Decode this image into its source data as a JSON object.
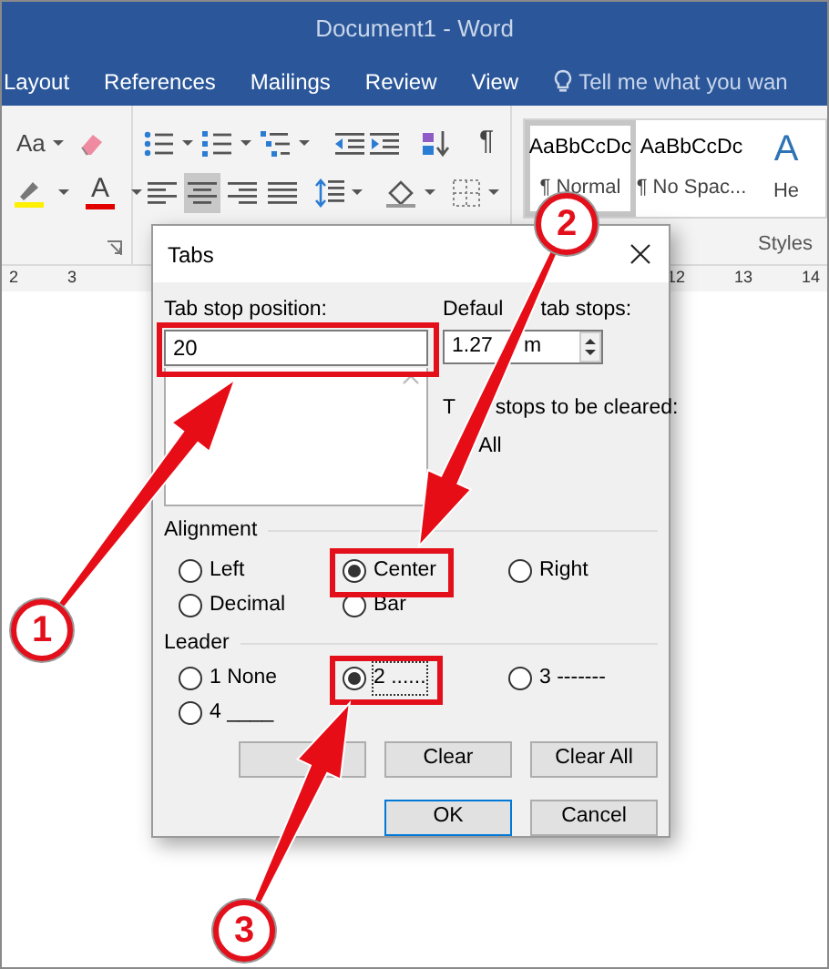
{
  "window": {
    "title": "Document1 - Word"
  },
  "ribbon_tabs": [
    {
      "label": "Layout"
    },
    {
      "label": "References"
    },
    {
      "label": "Mailings"
    },
    {
      "label": "Review"
    },
    {
      "label": "View"
    }
  ],
  "tell_me": {
    "placeholder": "Tell me what you wan"
  },
  "font_group": {
    "font_size_button": "Aa",
    "font_color_button": "A"
  },
  "paragraph_group": {
    "show_marks_button": "¶"
  },
  "paragraph_alignment": [
    {
      "selected": false
    },
    {
      "selected": true
    },
    {
      "selected": false
    },
    {
      "selected": false
    }
  ],
  "styles": {
    "group_label": "Styles",
    "items": [
      {
        "preview": "AaBbCcDc",
        "name": "¶ Normal",
        "selected": true
      },
      {
        "preview": "AaBbCcDc",
        "name": "¶ No Spac...",
        "selected": false
      },
      {
        "preview": "A",
        "name": "He",
        "selected": false
      }
    ]
  },
  "ruler": {
    "left_numbers": [
      "2",
      "3"
    ],
    "right_numbers": [
      "12",
      "13",
      "14"
    ]
  },
  "dialog": {
    "title": "Tabs",
    "tab_stop_position": {
      "label": "Tab stop position:",
      "value": "20"
    },
    "default_tab_stops": {
      "label_parts": [
        "Defaul",
        "tab stops:"
      ],
      "value_parts": [
        "1.27",
        "m"
      ]
    },
    "tab_stops_to_be_cleared": {
      "label_parts": [
        "T",
        "stops to be cleared:"
      ],
      "value": "All"
    },
    "alignment": {
      "label": "Alignment",
      "options": [
        {
          "label": "Left",
          "selected": false
        },
        {
          "label": "Center",
          "selected": true
        },
        {
          "label": "Right",
          "selected": false
        },
        {
          "label": "Decimal",
          "selected": false
        },
        {
          "label": "Bar",
          "selected": false
        }
      ]
    },
    "leader": {
      "label": "Leader",
      "options": [
        {
          "label": "1 None",
          "selected": false
        },
        {
          "label": "2 ......",
          "selected": true
        },
        {
          "label": "3 -------",
          "selected": false
        },
        {
          "label": "4 ____",
          "selected": false
        }
      ]
    },
    "action_buttons": [
      {
        "label": "Clear"
      },
      {
        "label": "Clear All"
      }
    ],
    "footer_buttons": [
      {
        "label": "OK",
        "default": true
      },
      {
        "label": "Cancel",
        "default": false
      }
    ]
  },
  "callouts": [
    {
      "number": "1"
    },
    {
      "number": "2"
    },
    {
      "number": "3"
    }
  ]
}
